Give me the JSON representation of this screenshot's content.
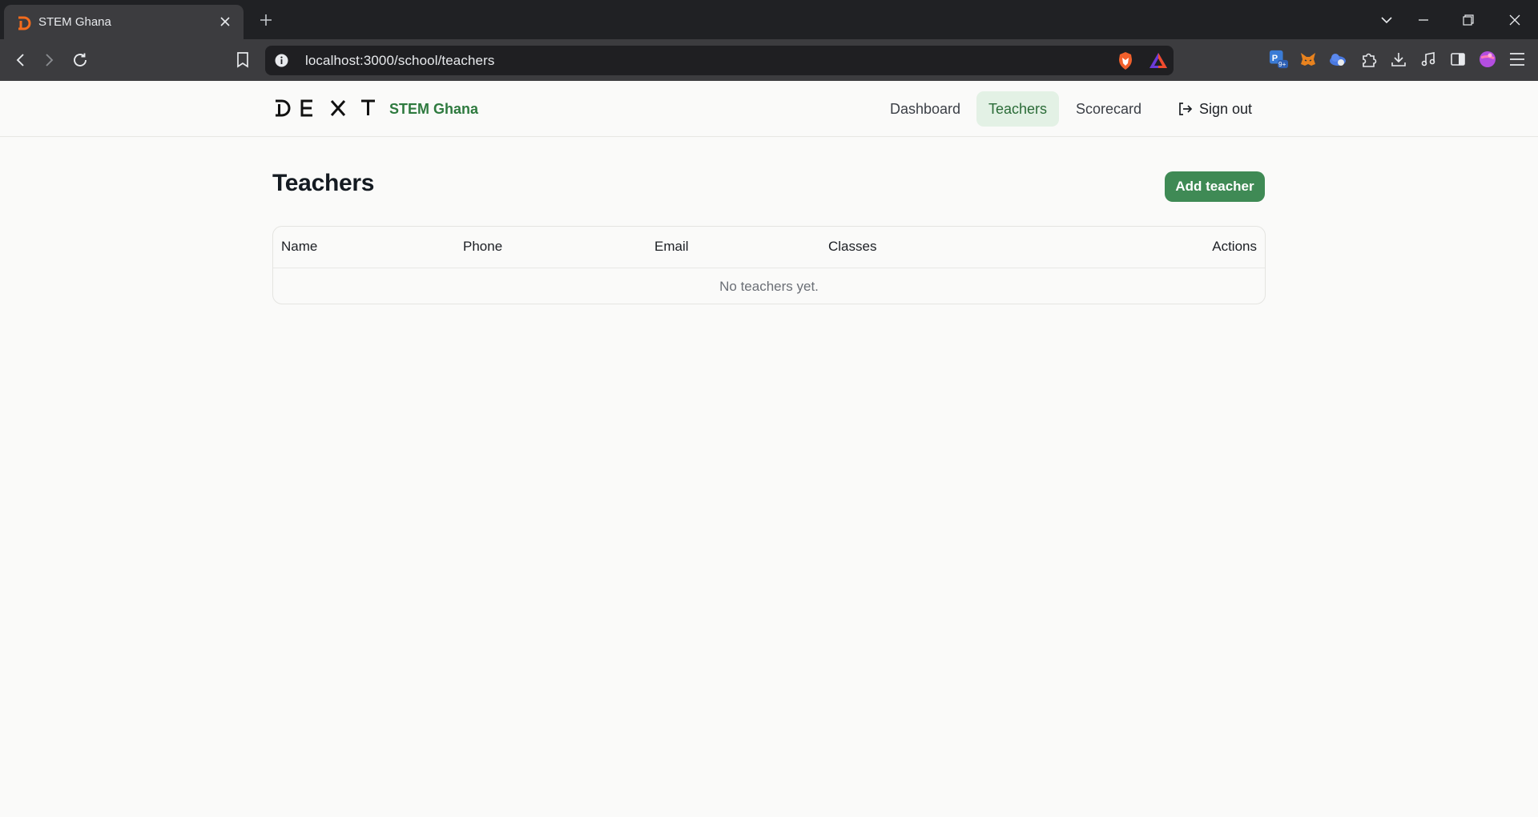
{
  "browser": {
    "tab_title": "STEM Ghana",
    "url": "localhost:3000/school/teachers"
  },
  "app": {
    "logo_letters": [
      "D",
      "E",
      "X",
      "T"
    ],
    "school_name": "STEM Ghana",
    "nav": {
      "dashboard": "Dashboard",
      "teachers": "Teachers",
      "scorecard": "Scorecard",
      "active": "teachers"
    },
    "sign_out": "Sign out"
  },
  "main": {
    "title": "Teachers",
    "add_button": "Add teacher",
    "table": {
      "columns": {
        "name": "Name",
        "phone": "Phone",
        "email": "Email",
        "classes": "Classes",
        "actions": "Actions"
      },
      "rows": [],
      "empty_text": "No teachers yet."
    }
  },
  "colors": {
    "accent": "#3f8a55",
    "school_name": "#2e7a3f",
    "active_nav_bg": "#e3f1e5",
    "page_bg": "#fafaf9"
  }
}
